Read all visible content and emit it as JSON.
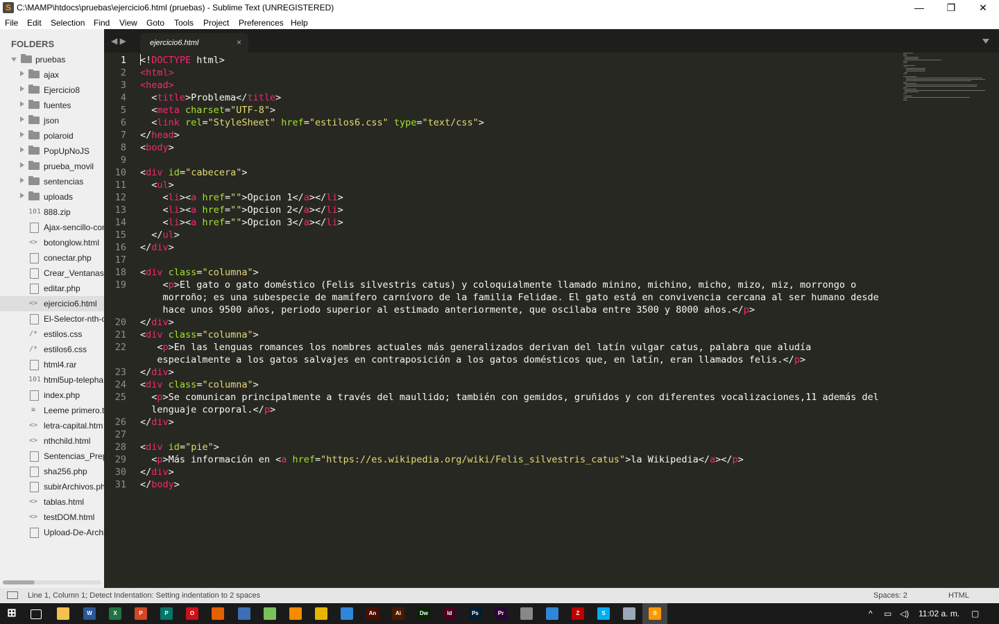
{
  "window": {
    "title": "C:\\MAMP\\htdocs\\pruebas\\ejercicio6.html (pruebas) - Sublime Text (UNREGISTERED)",
    "minimize": "—",
    "maximize": "❐",
    "close": "✕"
  },
  "menu": [
    "File",
    "Edit",
    "Selection",
    "Find",
    "View",
    "Goto",
    "Tools",
    "Project",
    "Preferences",
    "Help"
  ],
  "sidebar": {
    "header": "FOLDERS",
    "root": "pruebas",
    "folders": [
      "ajax",
      "Ejercicio8",
      "fuentes",
      "json",
      "polaroid",
      "PopUpNoJS",
      "prueba_movil",
      "sentencias",
      "uploads"
    ],
    "files": [
      {
        "name": "888.zip",
        "icon": "binary-file-icon",
        "glyph": "101"
      },
      {
        "name": "Ajax-sencillo-con",
        "icon": "file-icon",
        "glyph": ""
      },
      {
        "name": "botonglow.html",
        "icon": "html-file-icon",
        "glyph": "<>"
      },
      {
        "name": "conectar.php",
        "icon": "file-icon",
        "glyph": ""
      },
      {
        "name": "Crear_Ventanas_",
        "icon": "file-icon",
        "glyph": ""
      },
      {
        "name": "editar.php",
        "icon": "file-icon",
        "glyph": ""
      },
      {
        "name": "ejercicio6.html",
        "icon": "html-file-icon",
        "glyph": "<>",
        "selected": true
      },
      {
        "name": "El-Selector-nth-c",
        "icon": "file-icon",
        "glyph": ""
      },
      {
        "name": "estilos.css",
        "icon": "css-file-icon",
        "glyph": "/*"
      },
      {
        "name": "estilos6.css",
        "icon": "css-file-icon",
        "glyph": "/*"
      },
      {
        "name": "html4.rar",
        "icon": "file-icon",
        "glyph": ""
      },
      {
        "name": "html5up-telepha",
        "icon": "binary-file-icon",
        "glyph": "101"
      },
      {
        "name": "index.php",
        "icon": "file-icon",
        "glyph": ""
      },
      {
        "name": "Leeme primero.t",
        "icon": "text-file-icon",
        "glyph": "≡"
      },
      {
        "name": "letra-capital.htm",
        "icon": "html-file-icon",
        "glyph": "<>"
      },
      {
        "name": "nthchild.html",
        "icon": "html-file-icon",
        "glyph": "<>"
      },
      {
        "name": "Sentencias_Prepa",
        "icon": "file-icon",
        "glyph": ""
      },
      {
        "name": "sha256.php",
        "icon": "file-icon",
        "glyph": ""
      },
      {
        "name": "subirArchivos.ph",
        "icon": "file-icon",
        "glyph": ""
      },
      {
        "name": "tablas.html",
        "icon": "html-file-icon",
        "glyph": "<>"
      },
      {
        "name": "testDOM.html",
        "icon": "html-file-icon",
        "glyph": "<>"
      },
      {
        "name": "Upload-De-Archi",
        "icon": "file-icon",
        "glyph": ""
      }
    ]
  },
  "tabs": [
    {
      "label": "ejercicio6.html",
      "close": "×"
    }
  ],
  "nav": "◀ ▶",
  "editor": {
    "active_line": 1,
    "lines": [
      {
        "n": "1",
        "html": "&lt;!<span class=\"t\">DOCTYPE</span> html&gt;"
      },
      {
        "n": "2",
        "html": "<span class=\"t\">&lt;html&gt;</span>"
      },
      {
        "n": "3",
        "html": "<span class=\"t\">&lt;head&gt;</span>"
      },
      {
        "n": "4",
        "html": "  &lt;<span class=\"t\">title</span>&gt;Problema&lt;/<span class=\"t\">title</span>&gt;"
      },
      {
        "n": "5",
        "html": "  &lt;<span class=\"t\">meta</span> <span class=\"a\">charset</span>=<span class=\"s\">\"UTF-8\"</span>&gt;"
      },
      {
        "n": "6",
        "html": "  &lt;<span class=\"t\">link</span> <span class=\"a\">rel</span>=<span class=\"s\">\"StyleSheet\"</span> <span class=\"a\">href</span>=<span class=\"s\">\"estilos6.css\"</span> <span class=\"a\">type</span>=<span class=\"s\">\"text/css\"</span>&gt;"
      },
      {
        "n": "7",
        "html": "&lt;/<span class=\"t\">head</span>&gt;"
      },
      {
        "n": "8",
        "html": "&lt;<span class=\"t\">body</span>&gt;"
      },
      {
        "n": "9",
        "html": ""
      },
      {
        "n": "10",
        "html": "&lt;<span class=\"t\">div</span> <span class=\"a\">id</span>=<span class=\"s\">\"cabecera\"</span>&gt;"
      },
      {
        "n": "11",
        "html": "  &lt;<span class=\"t\">ul</span>&gt;"
      },
      {
        "n": "12",
        "html": "    &lt;<span class=\"t\">li</span>&gt;&lt;<span class=\"t\">a</span> <span class=\"a\">href</span>=<span class=\"s\">\"\"</span>&gt;Opcion 1&lt;/<span class=\"t\">a</span>&gt;&lt;/<span class=\"t\">li</span>&gt;"
      },
      {
        "n": "13",
        "html": "    &lt;<span class=\"t\">li</span>&gt;&lt;<span class=\"t\">a</span> <span class=\"a\">href</span>=<span class=\"s\">\"\"</span>&gt;Opcion 2&lt;/<span class=\"t\">a</span>&gt;&lt;/<span class=\"t\">li</span>&gt;"
      },
      {
        "n": "14",
        "html": "    &lt;<span class=\"t\">li</span>&gt;&lt;<span class=\"t\">a</span> <span class=\"a\">href</span>=<span class=\"s\">\"\"</span>&gt;Opcion 3&lt;/<span class=\"t\">a</span>&gt;&lt;/<span class=\"t\">li</span>&gt;"
      },
      {
        "n": "15",
        "html": "  &lt;/<span class=\"t\">ul</span>&gt;"
      },
      {
        "n": "16",
        "html": "&lt;/<span class=\"t\">div</span>&gt;"
      },
      {
        "n": "17",
        "html": ""
      },
      {
        "n": "18",
        "html": "&lt;<span class=\"t\">div</span> <span class=\"a\">class</span>=<span class=\"s\">\"columna\"</span>&gt;"
      },
      {
        "n": "19",
        "html": "    &lt;<span class=\"t\">p</span>&gt;El gato o gato doméstico (Felis silvestris catus) y coloquialmente llamado minino, michino, micho, mizo, miz, morrongo o"
      },
      {
        "n": "",
        "html": "    morroño; es una subespecie de mamífero carnívoro de la familia Felidae. El gato está en convivencia cercana al ser humano desde"
      },
      {
        "n": "",
        "html": "    hace unos 9500 años, periodo superior al estimado anteriormente, que oscilaba entre 3500 y 8000 años.&lt;/<span class=\"t\">p</span>&gt;"
      },
      {
        "n": "20",
        "html": "&lt;/<span class=\"t\">div</span>&gt;"
      },
      {
        "n": "21",
        "html": "&lt;<span class=\"t\">div</span> <span class=\"a\">class</span>=<span class=\"s\">\"columna\"</span>&gt;"
      },
      {
        "n": "22",
        "html": "   &lt;<span class=\"t\">p</span>&gt;En las lenguas romances los nombres actuales más generalizados derivan del latín vulgar catus, palabra que aludía"
      },
      {
        "n": "",
        "html": "   especialmente a los gatos salvajes en contraposición a los gatos domésticos que, en latín, eran llamados felis.&lt;/<span class=\"t\">p</span>&gt;"
      },
      {
        "n": "23",
        "html": "&lt;/<span class=\"t\">div</span>&gt;"
      },
      {
        "n": "24",
        "html": "&lt;<span class=\"t\">div</span> <span class=\"a\">class</span>=<span class=\"s\">\"columna\"</span>&gt;"
      },
      {
        "n": "25",
        "html": "  &lt;<span class=\"t\">p</span>&gt;Se comunican principalmente a través del maullido; también con gemidos, gruñidos y con diferentes vocalizaciones,11 además del"
      },
      {
        "n": "",
        "html": "  lenguaje corporal.&lt;/<span class=\"t\">p</span>&gt;"
      },
      {
        "n": "26",
        "html": "&lt;/<span class=\"t\">div</span>&gt;"
      },
      {
        "n": "27",
        "html": ""
      },
      {
        "n": "28",
        "html": "&lt;<span class=\"t\">div</span> <span class=\"a\">id</span>=<span class=\"s\">\"pie\"</span>&gt;"
      },
      {
        "n": "29",
        "html": "  &lt;<span class=\"t\">p</span>&gt;Más información en &lt;<span class=\"t\">a</span> <span class=\"a\">href</span>=<span class=\"s\">\"https://es.wikipedia.org/wiki/Felis_silvestris_catus\"</span>&gt;la Wikipedia&lt;/<span class=\"t\">a</span>&gt;&lt;/<span class=\"t\">p</span>&gt;"
      },
      {
        "n": "30",
        "html": "&lt;/<span class=\"t\">div</span>&gt;"
      },
      {
        "n": "31",
        "html": "&lt;/<span class=\"t\">body</span>&gt;"
      }
    ]
  },
  "status": {
    "message": "Line 1, Column 1; Detect Indentation: Setting indentation to 2 spaces",
    "spaces": "Spaces: 2",
    "syntax": "HTML"
  },
  "taskbar": {
    "apps": [
      {
        "name": "windows-start-icon",
        "label": "",
        "color": "#1a1a1a"
      },
      {
        "name": "task-view-icon",
        "label": "",
        "color": "#1a1a1a"
      },
      {
        "name": "file-explorer-icon",
        "label": "",
        "color": "#f2c14e"
      },
      {
        "name": "word-icon",
        "label": "W",
        "color": "#2b579a"
      },
      {
        "name": "excel-icon",
        "label": "X",
        "color": "#217346"
      },
      {
        "name": "powerpoint-icon",
        "label": "P",
        "color": "#d24726"
      },
      {
        "name": "publisher-icon",
        "label": "P",
        "color": "#077568"
      },
      {
        "name": "opera-icon",
        "label": "O",
        "color": "#cc0f16"
      },
      {
        "name": "firefox-icon",
        "label": "",
        "color": "#e66000"
      },
      {
        "name": "virtualbox-icon",
        "label": "",
        "color": "#3d6fb6"
      },
      {
        "name": "android-icon",
        "label": "",
        "color": "#78c257"
      },
      {
        "name": "vlc-icon",
        "label": "",
        "color": "#f48b00"
      },
      {
        "name": "app-icon",
        "label": "",
        "color": "#e8b400"
      },
      {
        "name": "app-cube-icon",
        "label": "",
        "color": "#2f87d9"
      },
      {
        "name": "animate-icon",
        "label": "An",
        "color": "#4a0d00"
      },
      {
        "name": "illustrator-icon",
        "label": "Ai",
        "color": "#4a1a00"
      },
      {
        "name": "dreamweaver-icon",
        "label": "Dw",
        "color": "#072401"
      },
      {
        "name": "indesign-icon",
        "label": "Id",
        "color": "#49021f"
      },
      {
        "name": "photoshop-icon",
        "label": "Ps",
        "color": "#001d34"
      },
      {
        "name": "premiere-icon",
        "label": "Pr",
        "color": "#2a0634"
      },
      {
        "name": "github-icon",
        "label": "",
        "color": "#888888"
      },
      {
        "name": "app-frame-icon",
        "label": "",
        "color": "#2f87d9"
      },
      {
        "name": "filezilla-icon",
        "label": "Z",
        "color": "#bf0000"
      },
      {
        "name": "skype-icon",
        "label": "S",
        "color": "#00aff0"
      },
      {
        "name": "paint-icon",
        "label": "",
        "color": "#9aa7b8"
      },
      {
        "name": "sublime-icon",
        "label": "S",
        "color": "#ff9800"
      }
    ],
    "clock": "11:02 a. m."
  }
}
